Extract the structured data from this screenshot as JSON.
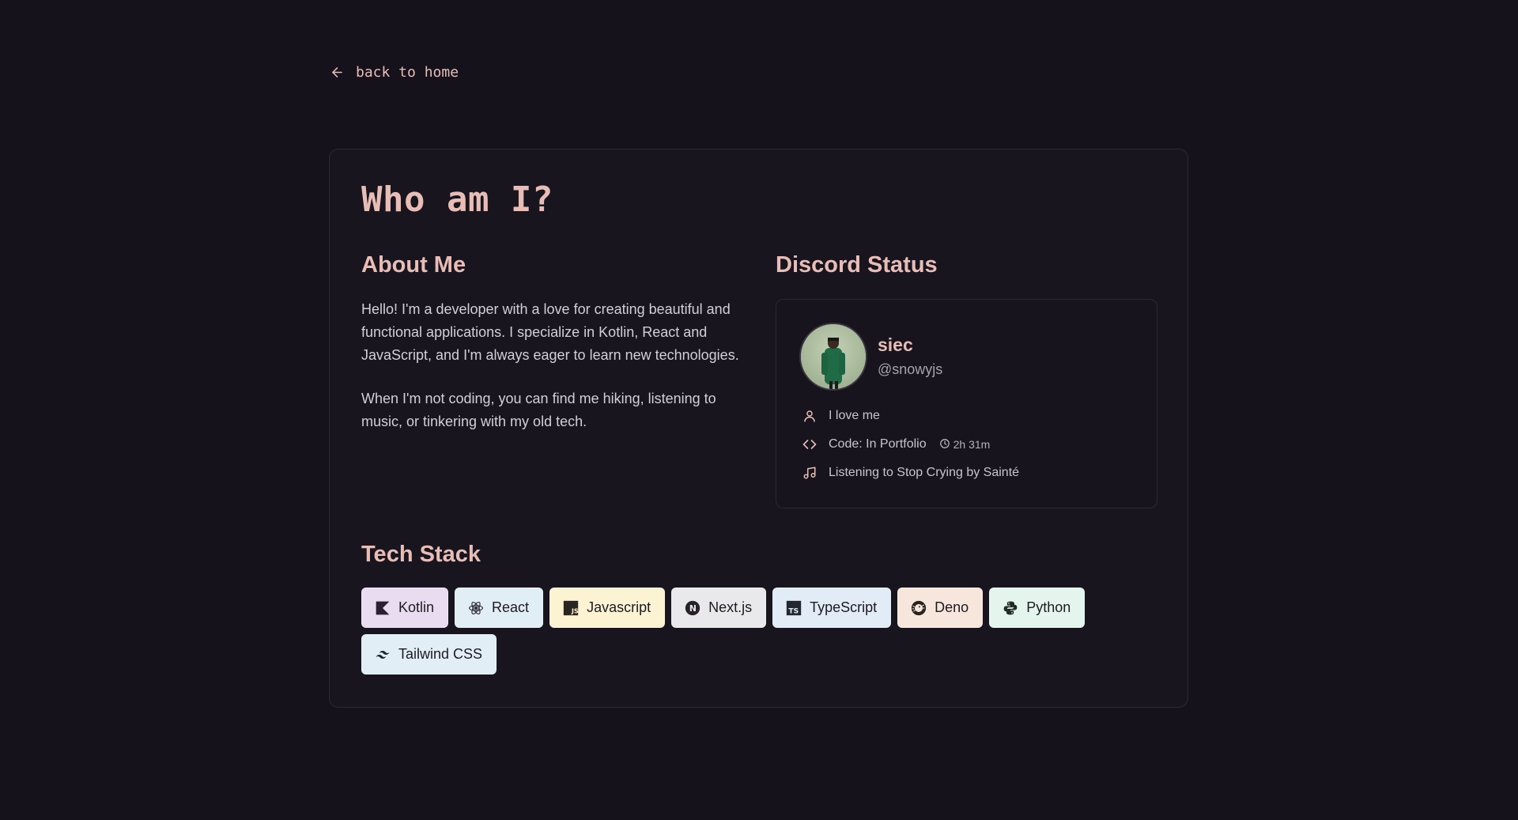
{
  "nav": {
    "back_label": "back to home"
  },
  "page": {
    "title": "Who am I?"
  },
  "about": {
    "heading": "About Me",
    "paragraph_1": "Hello! I'm a developer with a love for creating beautiful and functional applications. I specialize in Kotlin, React and JavaScript, and I'm always eager to learn new technologies.",
    "paragraph_2": "When I'm not coding, you can find me hiking, listening to music, or tinkering with my old tech."
  },
  "discord": {
    "heading": "Discord Status",
    "name": "siec",
    "handle": "@snowyjs",
    "status_text": "I love me",
    "activity": "Code: In Portfolio",
    "elapsed": "2h 31m",
    "listening": "Listening to Stop Crying by Sainté"
  },
  "tech": {
    "heading": "Tech Stack",
    "items": [
      {
        "label": "Kotlin",
        "icon": "kotlin-icon",
        "color": "#e9dcf0"
      },
      {
        "label": "React",
        "icon": "react-icon",
        "color": "#e2eef6"
      },
      {
        "label": "Javascript",
        "icon": "javascript-icon",
        "color": "#fcf3d2"
      },
      {
        "label": "Next.js",
        "icon": "nextjs-icon",
        "color": "#e9e8ea"
      },
      {
        "label": "TypeScript",
        "icon": "typescript-icon",
        "color": "#e1ecf6"
      },
      {
        "label": "Deno",
        "icon": "deno-icon",
        "color": "#f7e6dc"
      },
      {
        "label": "Python",
        "icon": "python-icon",
        "color": "#e4f5ee"
      },
      {
        "label": "Tailwind CSS",
        "icon": "tailwind-icon",
        "color": "#e1eef6"
      }
    ]
  },
  "colors": {
    "background": "#15121c",
    "accent": "#e8bdb6",
    "card_border": "#2c2834"
  }
}
